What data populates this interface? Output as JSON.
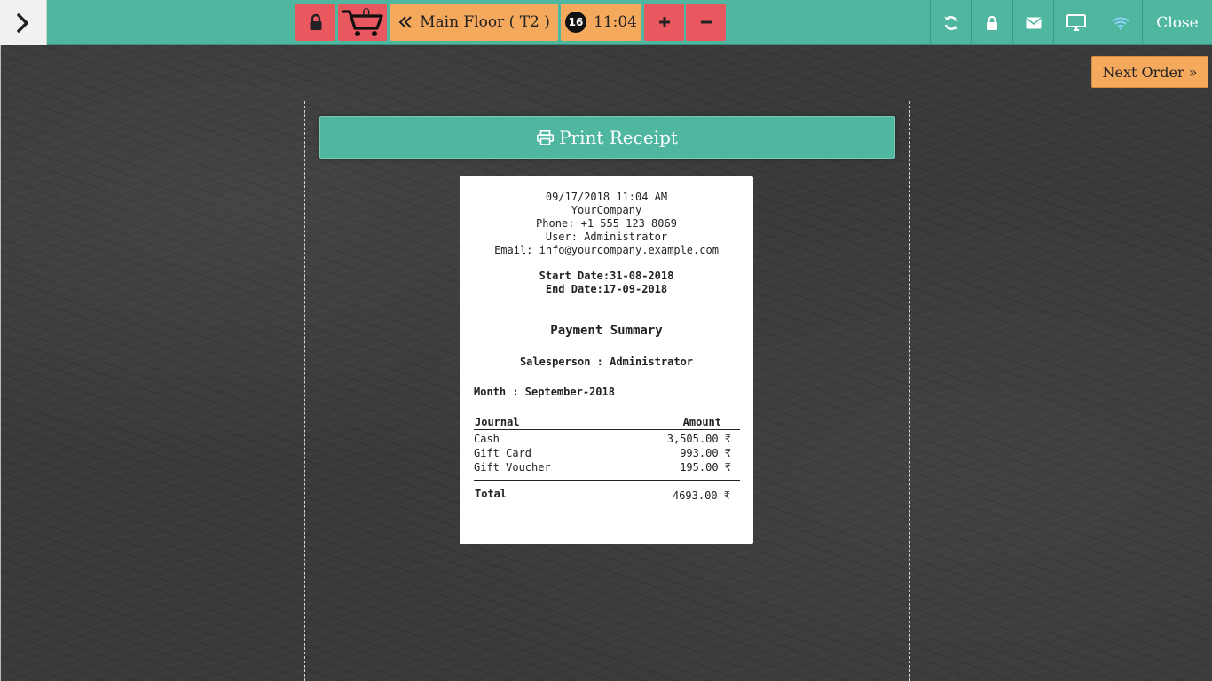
{
  "topbar": {
    "cart_count": "0",
    "floor_label": "Main Floor ( T2 )",
    "guests": "16",
    "time": "11:04",
    "close_label": "Close"
  },
  "colors": {
    "topbar": "#4fb6a0",
    "red_button": "#e8585e",
    "orange_button": "#f5a95c",
    "wifi_icon": "#8fd3ff"
  },
  "icons": [
    "chevron-right-icon",
    "lock-icon",
    "cart-icon",
    "double-chevron-left-icon",
    "plus-icon",
    "minus-icon",
    "refresh-icon",
    "envelope-icon",
    "monitor-icon",
    "wifi-icon",
    "print-icon"
  ],
  "next_order_label": "Next Order »",
  "print_label": "Print Receipt",
  "receipt": {
    "datetime": "09/17/2018 11:04 AM",
    "company": "YourCompany",
    "phone": "Phone: +1 555 123 8069",
    "user": "User: Administrator",
    "email": "Email: info@yourcompany.example.com",
    "start_date": "Start Date:31-08-2018",
    "end_date": "End Date:17-09-2018",
    "title": "Payment Summary",
    "salesperson": "Salesperson : Administrator",
    "month": "Month : September-2018",
    "col_journal": "Journal",
    "col_amount": "Amount",
    "rows": [
      {
        "journal": "Cash",
        "amount": "3,505.00 ₹"
      },
      {
        "journal": "Gift Card",
        "amount": "993.00 ₹"
      },
      {
        "journal": "Gift Voucher",
        "amount": "195.00 ₹"
      }
    ],
    "total_label": "Total",
    "total_value": "4693.00 ₹"
  }
}
